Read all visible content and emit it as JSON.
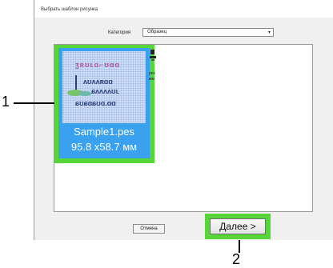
{
  "dialog": {
    "title": "Выбрать шаблон рисунка",
    "category_label": "Категория",
    "category_value": "Образец",
    "cancel_label": "Отмена",
    "next_label": "Далее >"
  },
  "selected_item": {
    "name": "Sample1.pes",
    "size": "95.8 x58.7 мм"
  },
  "second_item": {
    "name": "pes",
    "size": "мм"
  },
  "callouts": [
    "1",
    "2"
  ],
  "colors": {
    "highlight": "#57d63a",
    "selection": "#3aa0f0"
  }
}
